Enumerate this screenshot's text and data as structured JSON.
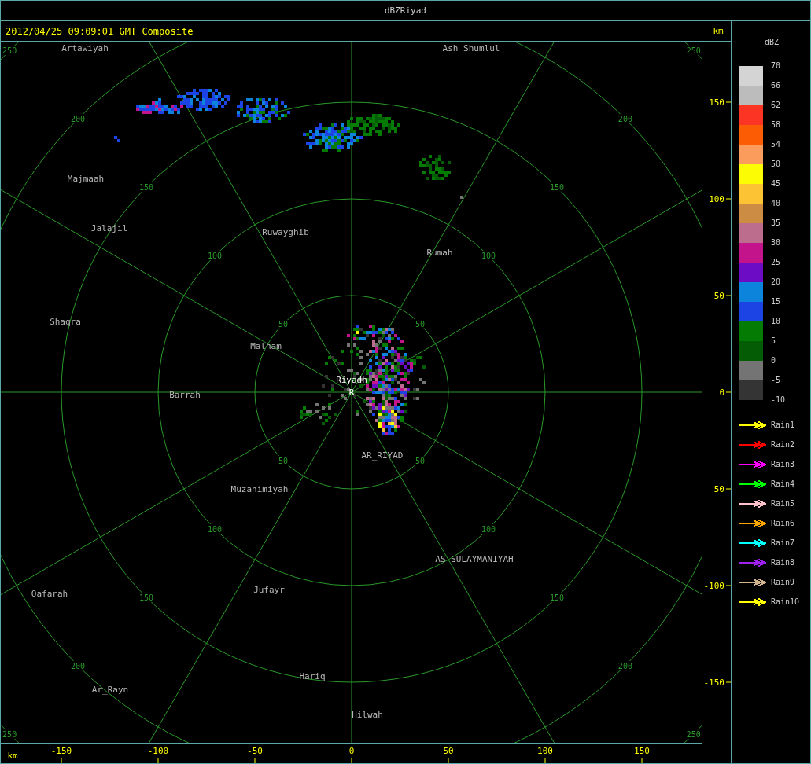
{
  "window": {
    "title": "dBZRiyad"
  },
  "header": {
    "timestamp": "2012/04/25 09:09:01 GMT Composite"
  },
  "map": {
    "range_rings": [
      {
        "labels": [
          "50",
          "50",
          "50",
          "50"
        ]
      },
      {
        "labels": [
          "100",
          "100",
          "100",
          "100"
        ]
      },
      {
        "labels": [
          "150",
          "150",
          "150",
          "150"
        ]
      },
      {
        "labels": [
          "200",
          "200",
          "200",
          "200"
        ]
      },
      {
        "labels": [
          "250",
          "250",
          "250",
          "250"
        ]
      }
    ],
    "cities": [
      {
        "name": "Artawiyah"
      },
      {
        "name": "Ash_Shumlul"
      },
      {
        "name": "Majmaah"
      },
      {
        "name": "Jalajil"
      },
      {
        "name": "Ruwayghib"
      },
      {
        "name": "Rumah"
      },
      {
        "name": "Shaqra"
      },
      {
        "name": "Malham"
      },
      {
        "name": "Barrah"
      },
      {
        "name": "AR_RIYAD"
      },
      {
        "name": "Muzahimiyah"
      },
      {
        "name": "AS_SULAYMANIYAH"
      },
      {
        "name": "Qafarah"
      },
      {
        "name": "Jufayr"
      },
      {
        "name": "Hariq"
      },
      {
        "name": "Ar_Rayn"
      },
      {
        "name": "Hilwah"
      }
    ],
    "site": {
      "name": "Riyadh",
      "marker": "R"
    }
  },
  "y_axis": {
    "unit": "km",
    "ticks": [
      "150",
      "100",
      "50",
      "0",
      "-50",
      "-100",
      "-150"
    ]
  },
  "x_axis": {
    "unit": "km",
    "ticks": [
      "-150",
      "-100",
      "-50",
      "0",
      "50",
      "100",
      "150"
    ]
  },
  "legend": {
    "title": "dBZ",
    "swatches": [
      {
        "color": "#d4d4d4"
      },
      {
        "color": "#bcbcbc"
      },
      {
        "color": "#fc3424"
      },
      {
        "color": "#fc5c04"
      },
      {
        "color": "#fc9c5c"
      },
      {
        "color": "#fcfc04"
      },
      {
        "color": "#fcc434"
      },
      {
        "color": "#cc8c44"
      },
      {
        "color": "#bc6c8c"
      },
      {
        "color": "#c4148c"
      },
      {
        "color": "#6c0cc4"
      },
      {
        "color": "#0c84dc"
      },
      {
        "color": "#1c44e4"
      },
      {
        "color": "#047c04"
      },
      {
        "color": "#045c04"
      },
      {
        "color": "#747474"
      },
      {
        "color": "#343434"
      }
    ],
    "labels": [
      "70",
      "66",
      "62",
      "58",
      "54",
      "50",
      "45",
      "40",
      "35",
      "30",
      "25",
      "20",
      "15",
      "10",
      "5",
      "0",
      "-5",
      "-10"
    ]
  },
  "tracks_legend": [
    {
      "label": "Rain1",
      "color": "#ffff00"
    },
    {
      "label": "Rain2",
      "color": "#ff0000"
    },
    {
      "label": "Rain3",
      "color": "#ff00ff"
    },
    {
      "label": "Rain4",
      "color": "#00ff00"
    },
    {
      "label": "Rain5",
      "color": "#ffc0cb"
    },
    {
      "label": "Rain6",
      "color": "#ffa500"
    },
    {
      "label": "Rain7",
      "color": "#00ffff"
    },
    {
      "label": "Rain8",
      "color": "#a020f0"
    },
    {
      "label": "Rain9",
      "color": "#d2b48c"
    },
    {
      "label": "Rain10",
      "color": "#ffff00"
    }
  ]
}
